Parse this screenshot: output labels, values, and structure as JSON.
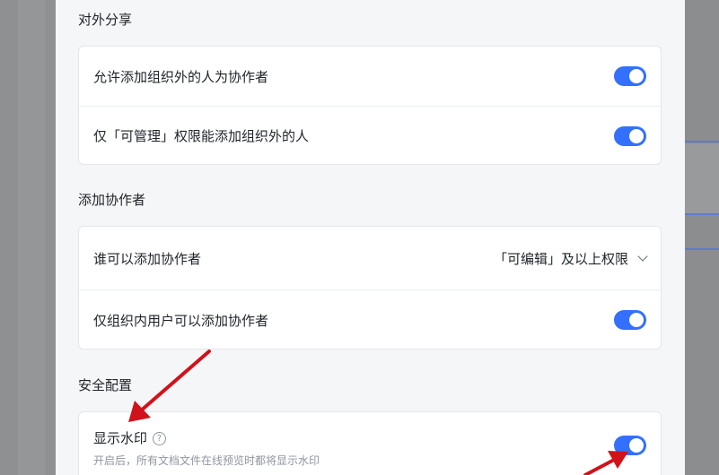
{
  "sections": {
    "external_share": {
      "title": "对外分享",
      "rows": [
        {
          "label": "允许添加组织外的人为协作者",
          "toggle": "on"
        },
        {
          "label": "仅「可管理」权限能添加组织外的人",
          "toggle": "on"
        }
      ]
    },
    "add_collaborator": {
      "title": "添加协作者",
      "who_can_add": {
        "label": "谁可以添加协作者",
        "value": "「可编辑」及以上权限"
      },
      "internal_only": {
        "label": "仅组织内用户可以添加协作者",
        "toggle": "on"
      }
    },
    "security": {
      "title": "安全配置",
      "watermark": {
        "label": "显示水印",
        "help_icon_char": "?",
        "description": "开启后，所有文档文件在线预览时都将显示水印",
        "toggle": "on"
      }
    }
  },
  "colors": {
    "accent": "#3370ff",
    "annotation_arrow": "#d0121b",
    "panel_bg": "#f5f6f7",
    "overlay": "#8a8b8d"
  },
  "icons": [
    "help-circle-icon",
    "chevron-down-icon",
    "red-arrow-annotation"
  ]
}
